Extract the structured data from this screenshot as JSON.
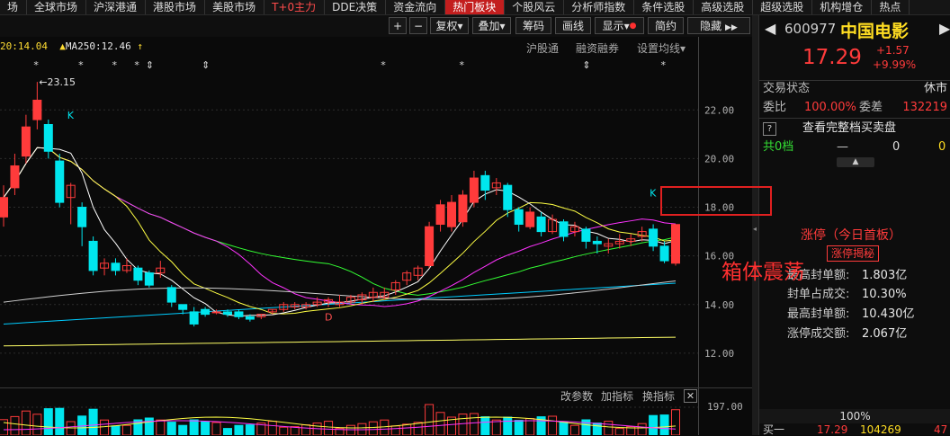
{
  "menu": [
    "场",
    "全球市场",
    "沪深港通",
    "港股市场",
    "美股市场",
    "T+0主力",
    "DDE决策",
    "资金流向",
    "热门板块",
    "个股风云",
    "分析师指数",
    "条件选股",
    "高级选股",
    "超级选股",
    "机构增仓",
    "热点"
  ],
  "toolbar": {
    "plus": "+",
    "minus": "−",
    "fuquan": "复权",
    "diejia": "叠加",
    "chouma": "筹码",
    "huaxian": "画线",
    "xianshi": "显示",
    "jianyue": "简约",
    "yincang": "隐藏",
    "arrows": "▶▶"
  },
  "indicators": {
    "ma20": "20:14.04",
    "ma250_label": "MA250:12.46"
  },
  "subtoolbar": {
    "hgt": "沪股通",
    "rzrq": "融资融券",
    "setma": "设置均线"
  },
  "chart_data": {
    "type": "candlestick",
    "price_labels": [
      "22.00",
      "20.00",
      "18.00",
      "16.00",
      "14.00",
      "12.00"
    ],
    "yrange": [
      11.0,
      24.3
    ],
    "high_annotation": "23.15",
    "marks": [
      "K",
      "K",
      "D"
    ],
    "lower_label": "197.00",
    "candles": [
      {
        "o": 17.6,
        "c": 18.4,
        "h": 18.9,
        "l": 17.2
      },
      {
        "o": 18.8,
        "c": 19.7,
        "h": 20.2,
        "l": 18.5
      },
      {
        "o": 20.1,
        "c": 21.3,
        "h": 21.8,
        "l": 19.8
      },
      {
        "o": 21.6,
        "c": 22.4,
        "h": 23.15,
        "l": 21.2
      },
      {
        "o": 21.4,
        "c": 20.3,
        "h": 21.6,
        "l": 20.0
      },
      {
        "o": 19.9,
        "c": 18.2,
        "h": 20.2,
        "l": 18.0
      },
      {
        "o": 18.4,
        "c": 18.9,
        "h": 19.0,
        "l": 17.3
      },
      {
        "o": 18.0,
        "c": 17.2,
        "h": 18.2,
        "l": 16.4
      },
      {
        "o": 16.6,
        "c": 15.4,
        "h": 16.8,
        "l": 15.2
      },
      {
        "o": 15.5,
        "c": 15.7,
        "h": 15.9,
        "l": 15.2
      },
      {
        "o": 15.7,
        "c": 15.4,
        "h": 15.9,
        "l": 15.2
      },
      {
        "o": 15.4,
        "c": 15.6,
        "h": 15.9,
        "l": 15.3
      },
      {
        "o": 15.5,
        "c": 15.0,
        "h": 15.6,
        "l": 14.8
      },
      {
        "o": 15.3,
        "c": 14.8,
        "h": 15.4,
        "l": 14.7
      },
      {
        "o": 15.3,
        "c": 15.5,
        "h": 15.8,
        "l": 15.1
      },
      {
        "o": 14.7,
        "c": 14.1,
        "h": 14.8,
        "l": 13.9
      },
      {
        "o": 14.0,
        "c": 13.8,
        "h": 14.0,
        "l": 13.6
      },
      {
        "o": 13.7,
        "c": 13.2,
        "h": 13.9,
        "l": 13.1
      },
      {
        "o": 13.8,
        "c": 13.6,
        "h": 13.9,
        "l": 13.5
      },
      {
        "o": 13.7,
        "c": 13.7,
        "h": 13.8,
        "l": 13.6
      },
      {
        "o": 13.7,
        "c": 13.6,
        "h": 13.8,
        "l": 13.5
      },
      {
        "o": 13.7,
        "c": 13.5,
        "h": 13.8,
        "l": 13.4
      },
      {
        "o": 13.5,
        "c": 13.4,
        "h": 13.6,
        "l": 13.3
      },
      {
        "o": 13.5,
        "c": 13.6,
        "h": 13.6,
        "l": 13.4
      },
      {
        "o": 13.7,
        "c": 13.8,
        "h": 13.8,
        "l": 13.6
      },
      {
        "o": 13.8,
        "c": 14.0,
        "h": 14.1,
        "l": 13.7
      },
      {
        "o": 13.9,
        "c": 14.0,
        "h": 14.1,
        "l": 13.8
      },
      {
        "o": 13.9,
        "c": 14.0,
        "h": 14.1,
        "l": 13.8
      },
      {
        "o": 14.0,
        "c": 14.1,
        "h": 14.3,
        "l": 13.9
      },
      {
        "o": 14.1,
        "c": 14.2,
        "h": 14.3,
        "l": 13.9
      },
      {
        "o": 14.0,
        "c": 14.1,
        "h": 14.4,
        "l": 13.9
      },
      {
        "o": 14.1,
        "c": 14.3,
        "h": 14.4,
        "l": 14.0
      },
      {
        "o": 14.2,
        "c": 14.4,
        "h": 14.5,
        "l": 14.0
      },
      {
        "o": 14.3,
        "c": 14.5,
        "h": 14.7,
        "l": 14.1
      },
      {
        "o": 14.3,
        "c": 14.5,
        "h": 14.7,
        "l": 14.2
      },
      {
        "o": 14.6,
        "c": 14.9,
        "h": 15.0,
        "l": 14.4
      },
      {
        "o": 15.0,
        "c": 15.3,
        "h": 15.4,
        "l": 14.8
      },
      {
        "o": 15.2,
        "c": 15.5,
        "h": 15.6,
        "l": 15.0
      },
      {
        "o": 15.6,
        "c": 17.2,
        "h": 17.4,
        "l": 15.5
      },
      {
        "o": 17.3,
        "c": 18.1,
        "h": 18.3,
        "l": 17.0
      },
      {
        "o": 17.2,
        "c": 18.2,
        "h": 18.5,
        "l": 17.0
      },
      {
        "o": 17.4,
        "c": 18.5,
        "h": 18.7,
        "l": 17.2
      },
      {
        "o": 18.2,
        "c": 19.2,
        "h": 19.5,
        "l": 18.0
      },
      {
        "o": 19.3,
        "c": 18.7,
        "h": 19.5,
        "l": 18.3
      },
      {
        "o": 18.8,
        "c": 19.0,
        "h": 19.2,
        "l": 18.5
      },
      {
        "o": 18.9,
        "c": 17.9,
        "h": 19.0,
        "l": 17.6
      },
      {
        "o": 17.9,
        "c": 17.3,
        "h": 18.0,
        "l": 17.0
      },
      {
        "o": 17.2,
        "c": 17.8,
        "h": 18.0,
        "l": 17.1
      },
      {
        "o": 17.6,
        "c": 17.0,
        "h": 17.8,
        "l": 16.8
      },
      {
        "o": 17.0,
        "c": 17.5,
        "h": 17.7,
        "l": 16.9
      },
      {
        "o": 17.4,
        "c": 16.8,
        "h": 17.5,
        "l": 16.6
      },
      {
        "o": 17.0,
        "c": 17.2,
        "h": 17.4,
        "l": 16.8
      },
      {
        "o": 17.1,
        "c": 16.6,
        "h": 17.2,
        "l": 16.3
      },
      {
        "o": 16.6,
        "c": 16.5,
        "h": 16.8,
        "l": 16.1
      },
      {
        "o": 16.4,
        "c": 16.5,
        "h": 16.7,
        "l": 16.1
      },
      {
        "o": 16.5,
        "c": 16.6,
        "h": 16.9,
        "l": 16.3
      },
      {
        "o": 16.6,
        "c": 16.7,
        "h": 16.9,
        "l": 16.4
      },
      {
        "o": 16.8,
        "c": 17.0,
        "h": 17.2,
        "l": 16.6
      },
      {
        "o": 17.1,
        "c": 16.4,
        "h": 17.3,
        "l": 16.2
      },
      {
        "o": 16.4,
        "c": 15.8,
        "h": 16.6,
        "l": 15.7
      },
      {
        "o": 15.7,
        "c": 17.29,
        "h": 17.29,
        "l": 15.6
      }
    ]
  },
  "lower_toolbar": {
    "change": "改参数",
    "add": "加指标",
    "switch": "换指标",
    "close": "✕"
  },
  "stock": {
    "code": "600977",
    "name": "中国电影",
    "price": "17.29",
    "chg": "+1.57",
    "pct": "+9.99%",
    "status_label": "交易状态",
    "status_value": "休市",
    "weibi_label": "委比",
    "weibi_value": "100.00%",
    "weicha_label": "委差",
    "weicha_value": "132219",
    "q": "?",
    "view_book": "查看完整档买卖盘",
    "gong_label": "共0档",
    "gong_dash": "—",
    "gong_v1": "0",
    "gong_v2": "0",
    "limit_title": "涨停（今日首板）",
    "limit_reveal": "涨停揭秘",
    "feng_label": "最高封单额:",
    "feng_value": "1.803亿",
    "zhan_label": "封单占成交:",
    "zhan_value": "10.30%",
    "max_label": "最高封单额:",
    "max_value": "10.430亿",
    "cj_label": "涨停成交额:",
    "cj_value": "2.067亿",
    "bottom_pct": "100%",
    "buy1_label": "买一",
    "buy1_price": "17.29",
    "buy1_vol": "104269",
    "buy1_extra": "47"
  },
  "annotation": "箱体震荡",
  "colors": {
    "up": "#ff3b3b",
    "down": "#00e6ee",
    "bg": "#0a0a0a",
    "ma5": "#ffffff",
    "ma10": "#ffff44",
    "ma20": "#ff33ff",
    "ma30": "#33ff33",
    "ma60": "#00ccff",
    "ma250": "#ffff66"
  }
}
